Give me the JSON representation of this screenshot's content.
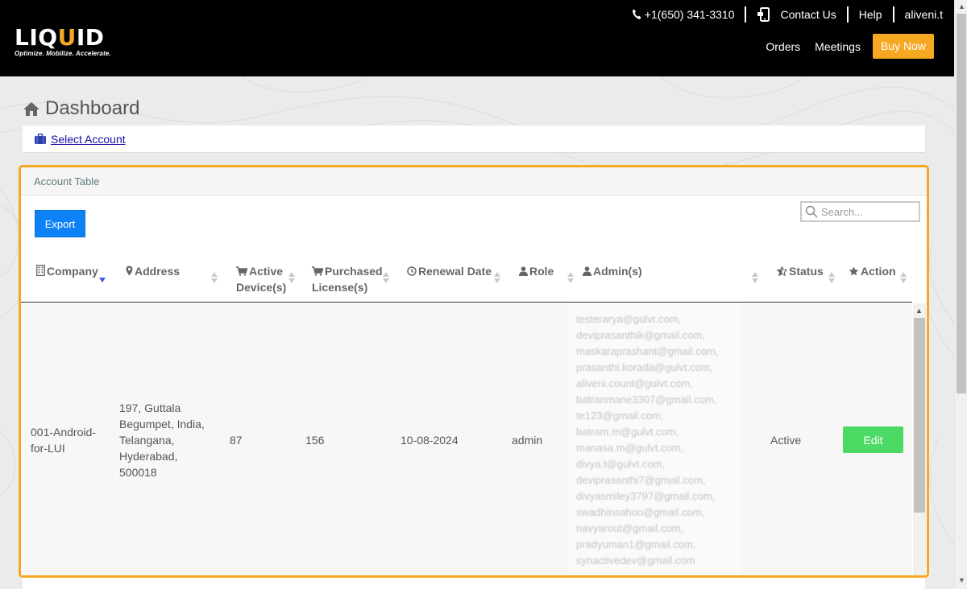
{
  "header": {
    "logo": {
      "pre": "LIQ",
      "accent": "U",
      "post": "ID",
      "tagline": "Optimize. Mobilize. Accelerate."
    },
    "phone": "+1(650) 341-3310",
    "contact": "Contact Us",
    "help": "Help",
    "user": "aliveni.t",
    "nav": {
      "orders": "Orders",
      "meetings": "Meetings",
      "buy_now": "Buy Now"
    }
  },
  "page": {
    "title": "Dashboard",
    "select_account": "Select Account"
  },
  "panel": {
    "title": "Account Table",
    "export": "Export",
    "search_placeholder": "Search..."
  },
  "table": {
    "headers": {
      "company": "Company",
      "address": "Address",
      "active": "Active Device(s)",
      "purchased": "Purchased License(s)",
      "renewal": "Renewal Date",
      "role": "Role",
      "admins": "Admin(s)",
      "status": "Status",
      "action": "Action"
    },
    "rows": [
      {
        "company": "001-Android-for-LUI",
        "address_lines": [
          "197, Guttala",
          "Begumpet, India,",
          "Telangana,",
          "Hyderabad,",
          "500018"
        ],
        "active": "87",
        "purchased": "156",
        "renewal": "10-08-2024",
        "role": "admin",
        "admins": [
          "testerarya@gulvt.com,",
          "deviprasanthik@gmail.com,",
          "maskaraprashant@gmail.com,",
          "prasanthi.korada@gulvt.com,",
          "aliveni.count@gulvt.com,",
          "batranmane3307@gmail.com,",
          "te123@gmail.com,",
          "batram.m@gulvt.com,",
          "manasa.m@gulvt.com,",
          "divya.t@gulvt.com,",
          "deviprasanthi7@gmail.com,",
          "divyasmiley3797@gmail.com,",
          "swadhinsahoo@gmail.com,",
          "navyarout@gmail.com,",
          "pradyuman1@gmail.com,",
          "synactivedev@gmail.com"
        ],
        "status": "Active",
        "action": "Edit"
      }
    ]
  },
  "colors": {
    "accent": "#f7a823",
    "export": "#0d82f7",
    "edit": "#4cd964",
    "header_bg": "#000000"
  }
}
